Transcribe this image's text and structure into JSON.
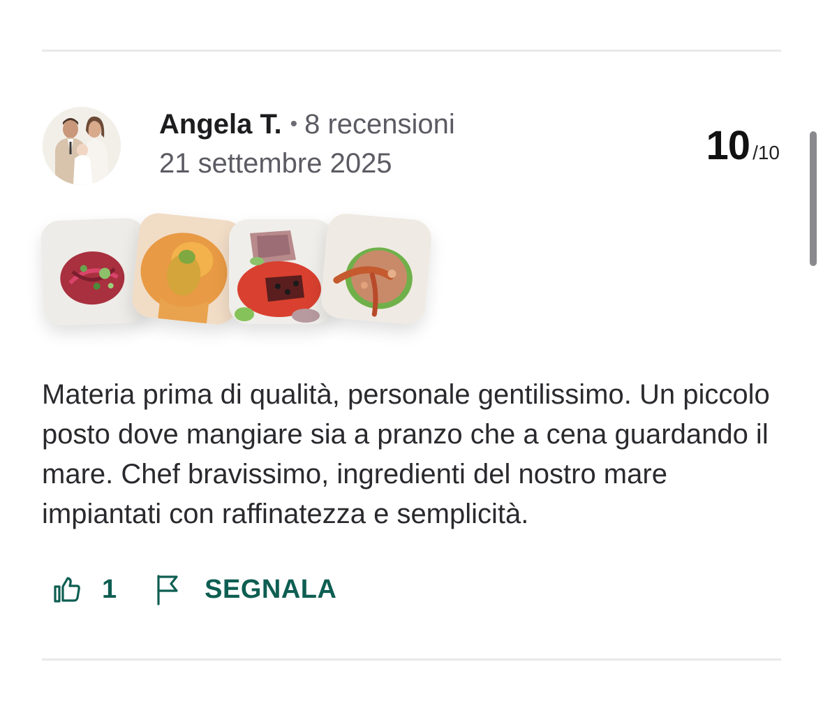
{
  "review": {
    "reviewer_name": "Angela T.",
    "separator": "•",
    "review_count": "8 recensioni",
    "date": "21 settembre 2025",
    "score": "10",
    "score_max": "/10",
    "text": "Materia prima di qualità, personale gentilissimo. Un piccolo posto dove mangiare sia a pranzo che a cena guardando il mare. Chef bravissimo, ingredienti del nostro mare impiantati con raffinatezza e semplicità.",
    "likes": "1",
    "report_label": "SEGNALA"
  },
  "icons": {
    "like": "thumbs-up-icon",
    "report": "flag-icon"
  },
  "colors": {
    "accent": "#0e5e52",
    "text": "#2a2a2e",
    "muted": "#5b5b63",
    "divider": "#e9e9ec"
  }
}
